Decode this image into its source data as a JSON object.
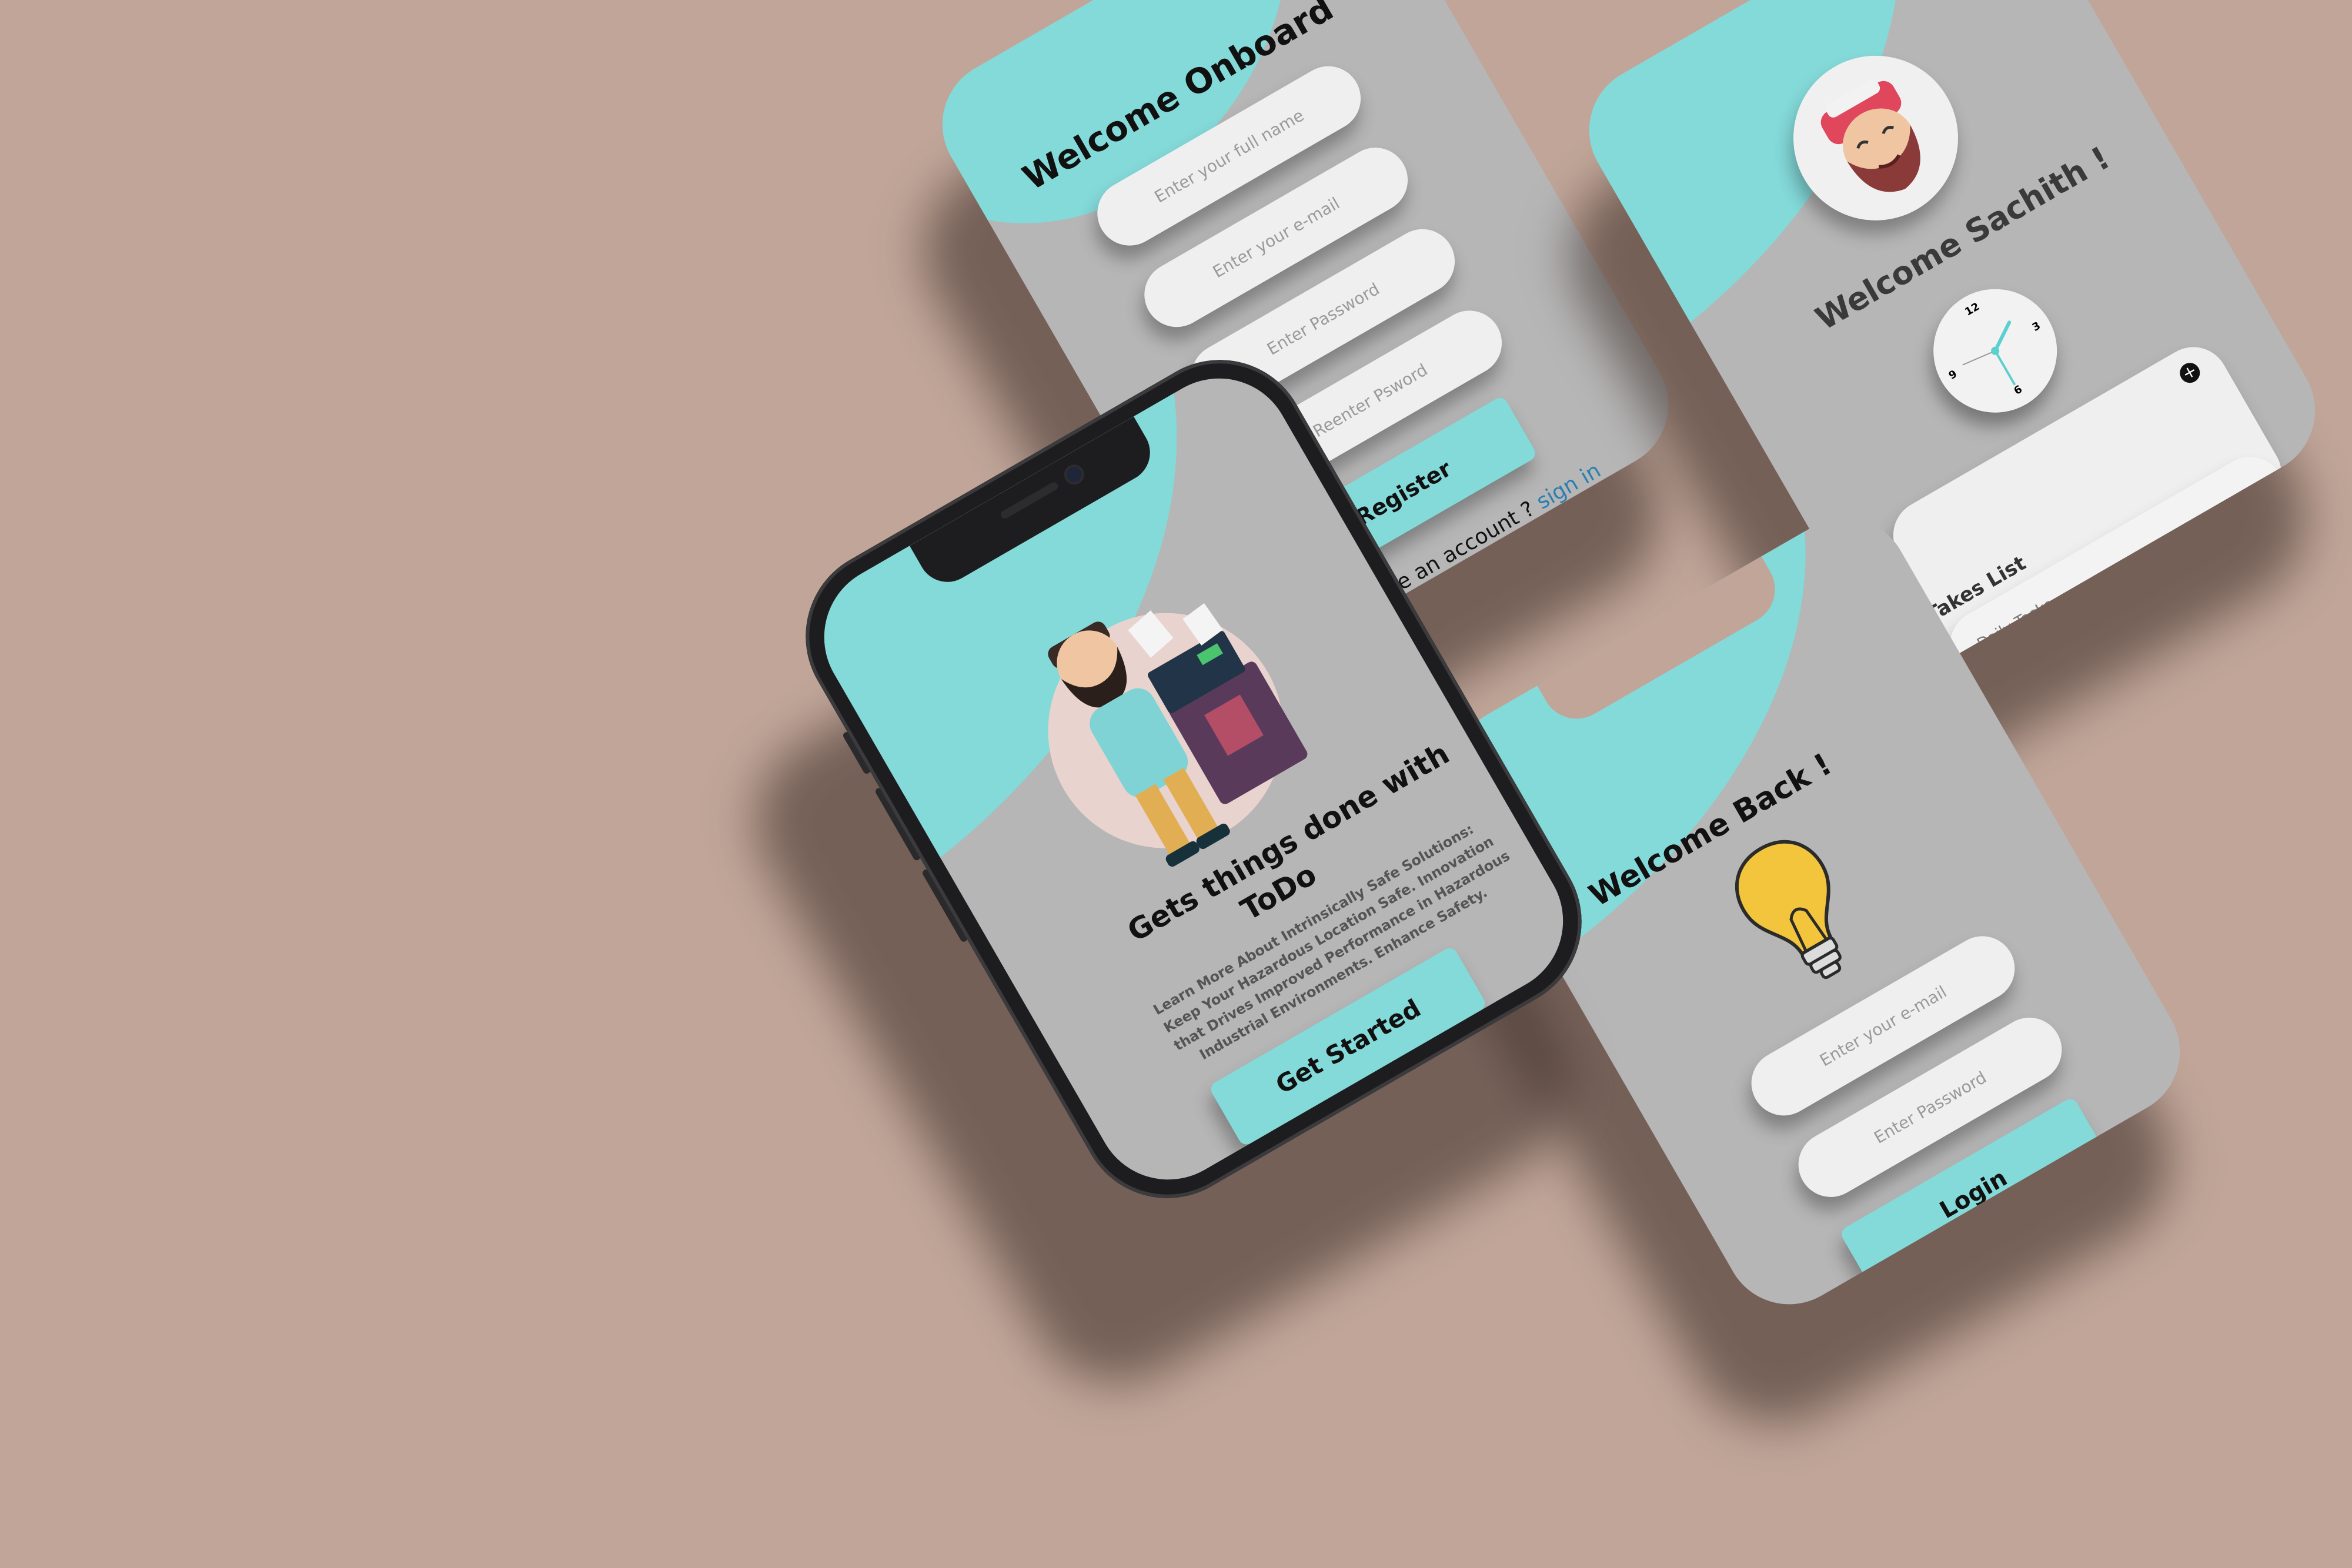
{
  "colors": {
    "background": "#c0a598",
    "screen_gray": "#b6b6b6",
    "accent_teal": "#84d9d9",
    "field": "#efefef",
    "link_blue": "#2b7fb0"
  },
  "register": {
    "title": "Welcome  Onboard",
    "full_name_placeholder": "Enter your full name",
    "email_placeholder": "Enter  your e-mail",
    "password_placeholder": "Enter Password",
    "reenter_placeholder": "Reenter Psword",
    "register_label": "Register",
    "account_text": "Already have an account ?",
    "sign_in_link": "sign in"
  },
  "onboarding": {
    "headline_line1": "Gets things done with",
    "headline_line2": "ToDo",
    "body_line1": "Learn More About Intrinsically Safe Solutions:",
    "body_line2": "Keep Your Hazardous Location Safe. Innovation",
    "body_line3": "that Drives Improved Performance in Hazardous",
    "body_line4": "Industrial Environments. Enhance Safety.",
    "cta_label": "Get Started",
    "illustration_icon": "man-with-computer-icon"
  },
  "dashboard": {
    "welcome": "Welcome  Sachith !",
    "avatar_icon": "bearded-man-avatar-icon",
    "clock": {
      "n12": "12",
      "n3": "3",
      "n6": "6",
      "n9": "9"
    },
    "list_title": "Takes List",
    "list_item": "Daily Tasks",
    "add_icon": "plus-circle-icon"
  },
  "login": {
    "title": "Welcome  Back !",
    "bulb_icon": "light-bulb-icon",
    "email_placeholder": "Enter  your e-mail",
    "password_placeholder": "Enter Password",
    "login_label": "Login"
  }
}
